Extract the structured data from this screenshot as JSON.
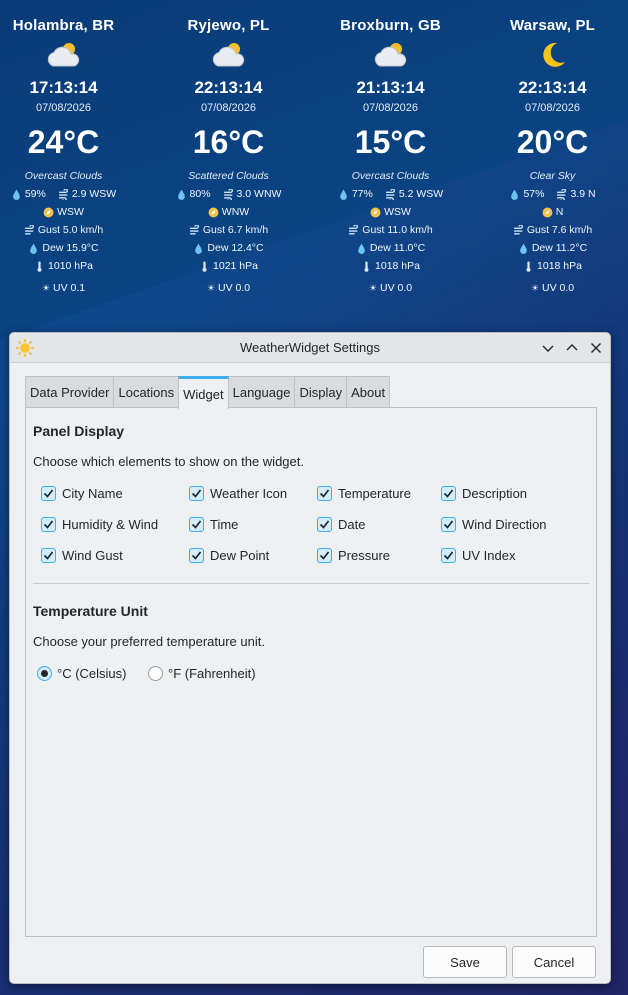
{
  "widget": {
    "cities": [
      {
        "name": "Holambra, BR",
        "icon": "cloud-sun-icon",
        "time": "17:13:14",
        "date": "07/08/2026",
        "temp": "24°C",
        "desc": "Overcast Clouds",
        "humidity": "59%",
        "wind": "2.9 WSW",
        "direction": "WSW",
        "gust": "Gust 5.0 km/h",
        "dew": "Dew 15.9°C",
        "pressure": "1010 hPa",
        "uv": "UV 0.1"
      },
      {
        "name": "Ryjewo, PL",
        "icon": "cloud-sun-icon",
        "time": "22:13:14",
        "date": "07/08/2026",
        "temp": "16°C",
        "desc": "Scattered Clouds",
        "humidity": "80%",
        "wind": "3.0 WNW",
        "direction": "WNW",
        "gust": "Gust 6.7 km/h",
        "dew": "Dew 12.4°C",
        "pressure": "1021 hPa",
        "uv": "UV 0.0"
      },
      {
        "name": "Broxburn, GB",
        "icon": "cloud-sun-icon",
        "time": "21:13:14",
        "date": "07/08/2026",
        "temp": "15°C",
        "desc": "Overcast Clouds",
        "humidity": "77%",
        "wind": "5.2 WSW",
        "direction": "WSW",
        "gust": "Gust 11.0 km/h",
        "dew": "Dew 11.0°C",
        "pressure": "1018 hPa",
        "uv": "UV 0.0"
      },
      {
        "name": "Warsaw, PL",
        "icon": "moon-icon",
        "time": "22:13:14",
        "date": "07/08/2026",
        "temp": "20°C",
        "desc": "Clear Sky",
        "humidity": "57%",
        "wind": "3.9 N",
        "direction": "N",
        "gust": "Gust 7.6 km/h",
        "dew": "Dew 11.2°C",
        "pressure": "1018 hPa",
        "uv": "UV 0.0"
      }
    ]
  },
  "dialog": {
    "title": "WeatherWidget Settings",
    "app_icon": "sun-icon",
    "tabs": [
      "Data Provider",
      "Locations",
      "Widget",
      "Language",
      "Display",
      "About"
    ],
    "active_tab": "Widget",
    "panel_display": {
      "heading": "Panel Display",
      "description": "Choose which elements to show on the widget.",
      "options": [
        {
          "label": "City Name",
          "checked": true
        },
        {
          "label": "Weather Icon",
          "checked": true
        },
        {
          "label": "Temperature",
          "checked": true
        },
        {
          "label": "Description",
          "checked": true
        },
        {
          "label": "Humidity & Wind",
          "checked": true
        },
        {
          "label": "Time",
          "checked": true
        },
        {
          "label": "Date",
          "checked": true
        },
        {
          "label": "Wind Direction",
          "checked": true
        },
        {
          "label": "Wind Gust",
          "checked": true
        },
        {
          "label": "Dew Point",
          "checked": true
        },
        {
          "label": "Pressure",
          "checked": true
        },
        {
          "label": "UV Index",
          "checked": true
        }
      ]
    },
    "temperature_unit": {
      "heading": "Temperature Unit",
      "description": "Choose your preferred temperature unit.",
      "celsius": "°C (Celsius)",
      "fahrenheit": "°F (Fahrenheit)",
      "selected": "celsius"
    },
    "buttons": {
      "save": "Save",
      "cancel": "Cancel"
    }
  },
  "colors": {
    "accent": "#3daee9",
    "window_bg": "#eff0f1",
    "moon": "#f5c518",
    "sun": "#f6c02e"
  }
}
